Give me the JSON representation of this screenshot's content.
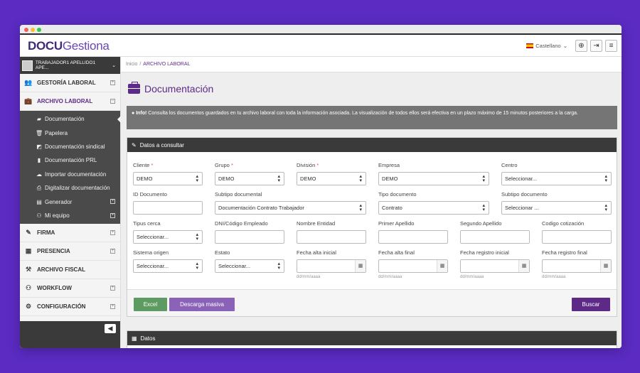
{
  "header": {
    "logo_bold": "DOCU",
    "logo_light": "Gestiona",
    "language": "Castellano"
  },
  "user": {
    "name": "TRABAJADOR1 APELLIDO1 APE..."
  },
  "nav": {
    "gestoria": "GESTORÍA LABORAL",
    "archivo": "ARCHIVO LABORAL",
    "firma": "FIRMA",
    "presencia": "PRESENCIA",
    "archivo_fiscal": "ARCHIVO FISCAL",
    "workflow": "WORKFLOW",
    "configuracion": "CONFIGURACIÓN"
  },
  "submenu": [
    {
      "label": "Documentación",
      "icon": "folder-open-icon"
    },
    {
      "label": "Papelera",
      "icon": "trash-icon"
    },
    {
      "label": "Documentación sindical",
      "icon": "puzzle-icon"
    },
    {
      "label": "Documentación PRL",
      "icon": "file-icon"
    },
    {
      "label": "Importar documentación",
      "icon": "cloud-upload-icon"
    },
    {
      "label": "Digitalizar documentación",
      "icon": "print-icon"
    },
    {
      "label": "Generador",
      "icon": "file-generate-icon"
    },
    {
      "label": "Mi equipo",
      "icon": "sitemap-icon"
    }
  ],
  "breadcrumb": {
    "home": "Inicio",
    "sep": "/",
    "current": "ARCHIVO LABORAL"
  },
  "page": {
    "title": "Documentación"
  },
  "info": {
    "bold": "Info!",
    "text": " Consulta los documentos guardados en tu archivo laboral con toda la información asociada. La visualización de todos ellos será efectiva en un plazo máximo de 15 minutos posteriores a la carga."
  },
  "form": {
    "title": "Datos a consultar",
    "fields": {
      "cliente": {
        "label": "Cliente",
        "value": "DEMO"
      },
      "grupo": {
        "label": "Grupo",
        "value": "DEMO"
      },
      "division": {
        "label": "División",
        "value": "DEMO"
      },
      "empresa": {
        "label": "Empresa",
        "value": "DEMO"
      },
      "centro": {
        "label": "Centro",
        "value": "Seleccionar..."
      },
      "id_documento": {
        "label": "ID Documento",
        "value": ""
      },
      "subtipo_documental": {
        "label": "Subtipo documental",
        "value": "Documentación Contrato Trabajador"
      },
      "tipo_documento": {
        "label": "Tipo documento",
        "value": "Contrato"
      },
      "subtipo_documento": {
        "label": "Subtipo documento",
        "value": "Seleccionar ..."
      },
      "tipus_cerca": {
        "label": "Tipus cerca",
        "value": "Seleccionar..."
      },
      "dni": {
        "label": "DNI/Código Empleado",
        "value": ""
      },
      "nombre_entidad": {
        "label": "Nombre Entidad",
        "value": ""
      },
      "primer_apellido": {
        "label": "Primer Apellido",
        "value": ""
      },
      "segundo_apellido": {
        "label": "Segundo Apellido",
        "value": ""
      },
      "codigo_cotizacion": {
        "label": "Codigo cotización",
        "value": ""
      },
      "sistema_origen": {
        "label": "Sistema origen",
        "value": "Seleccionar..."
      },
      "estato": {
        "label": "Estato",
        "value": "Seleccionar..."
      },
      "fecha_alta_inicial": {
        "label": "Fecha alta inicial",
        "hint": "dd/mm/aaaa"
      },
      "fecha_alta_final": {
        "label": "Fecha alta final",
        "hint": "dd/mm/aaaa"
      },
      "fecha_registro_inicial": {
        "label": "Fecha registro inicial",
        "hint": "dd/mm/aaaa"
      },
      "fecha_registro_final": {
        "label": "Fecha registro final",
        "hint": "dd/mm/aaaa"
      }
    },
    "required_mark": "*",
    "buttons": {
      "excel": "Excel",
      "descarga": "Descarga masiva",
      "buscar": "Buscar"
    }
  },
  "datos": {
    "title": "Datos"
  },
  "colors": {
    "primary": "#5d2a88",
    "background": "#5b2bc2",
    "dark": "#3a3a3a"
  }
}
